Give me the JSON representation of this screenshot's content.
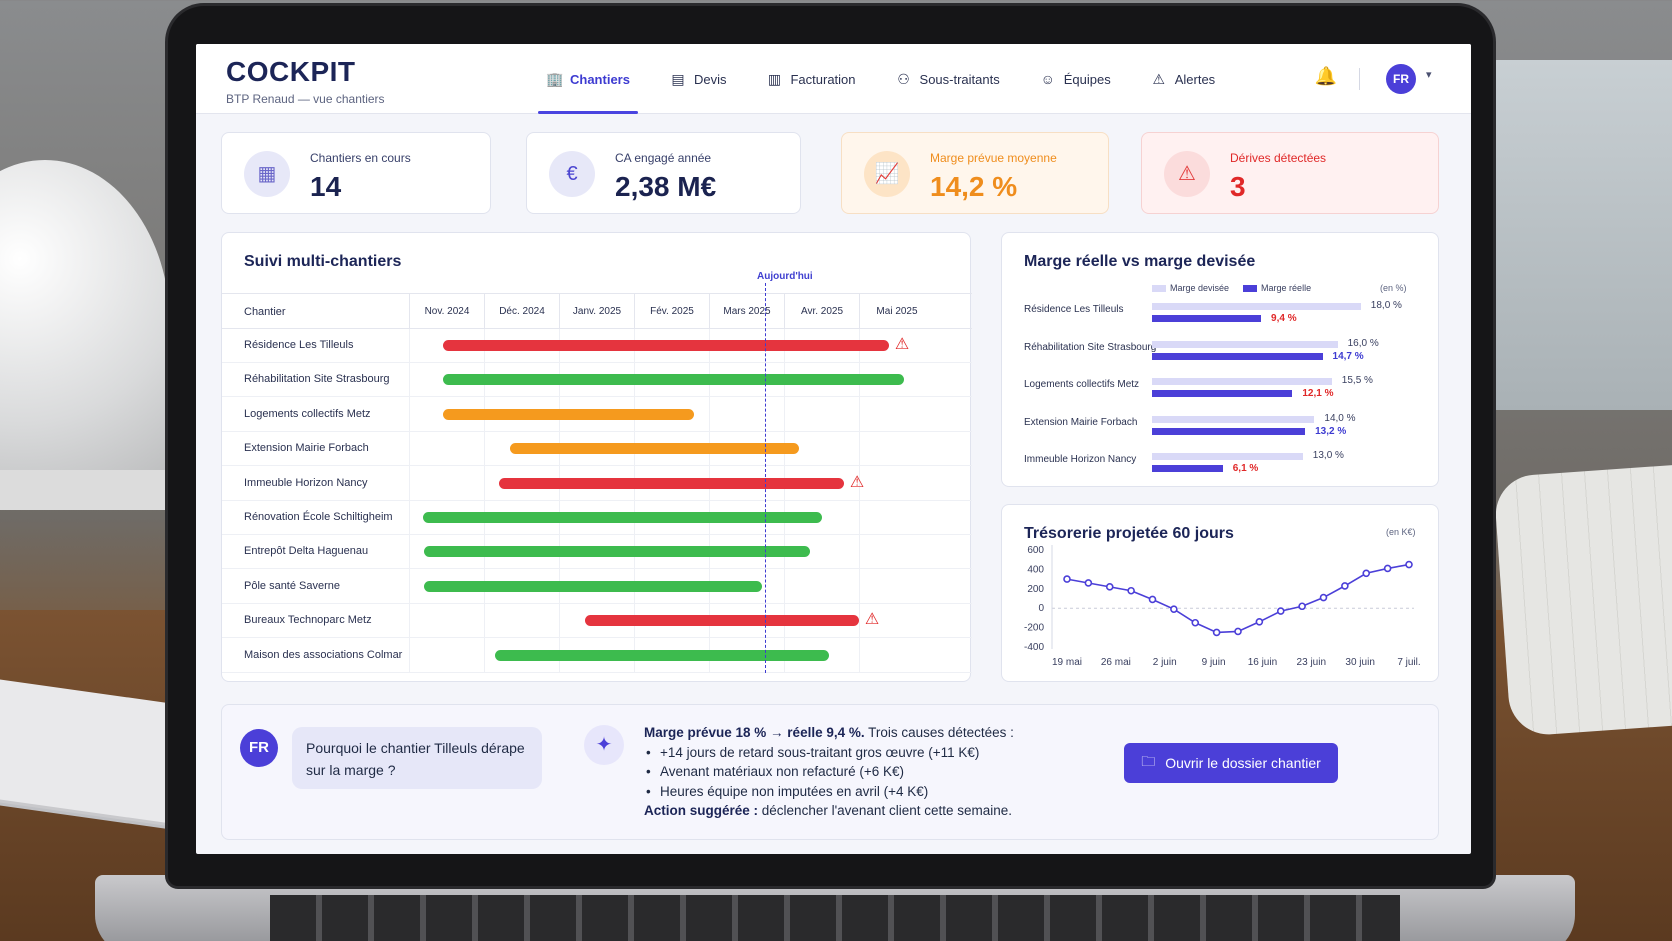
{
  "header": {
    "brand": "COCKPIT",
    "subtitle": "BTP Renaud — vue chantiers",
    "nav": [
      {
        "label": "Chantiers",
        "icon": "building-icon",
        "active": true
      },
      {
        "label": "Devis",
        "icon": "document-icon",
        "active": false
      },
      {
        "label": "Facturation",
        "icon": "invoice-icon",
        "active": false
      },
      {
        "label": "Sous-traitants",
        "icon": "users-icon",
        "active": false
      },
      {
        "label": "Équipes",
        "icon": "team-icon",
        "active": false
      },
      {
        "label": "Alertes",
        "icon": "warning-icon",
        "active": false
      }
    ],
    "avatar": "FR"
  },
  "kpis": [
    {
      "label": "Chantiers en cours",
      "value": "14",
      "icon": "building-icon"
    },
    {
      "label": "CA engagé année",
      "value": "2,38 M€",
      "icon": "euro-icon"
    },
    {
      "label": "Marge prévue moyenne",
      "value": "14,2 %",
      "icon": "trend-icon"
    },
    {
      "label": "Dérives détectées",
      "value": "3",
      "icon": "warning-icon"
    }
  ],
  "gantt": {
    "title": "Suivi multi-chantiers",
    "column_label": "Chantier",
    "today_label": "Aujourd'hui",
    "months": [
      "Nov. 2024",
      "Déc. 2024",
      "Janv. 2025",
      "Fév. 2025",
      "Mars 2025",
      "Avr. 2025",
      "Mai 2025"
    ],
    "rows": [
      {
        "name": "Résidence Les Tilleuls",
        "start": 0.45,
        "end": 6.4,
        "status": "red",
        "alert": true
      },
      {
        "name": "Réhabilitation Site Strasbourg",
        "start": 0.45,
        "end": 6.6,
        "status": "green",
        "alert": false
      },
      {
        "name": "Logements collectifs Metz",
        "start": 0.45,
        "end": 3.8,
        "status": "orange",
        "alert": false
      },
      {
        "name": "Extension Mairie Forbach",
        "start": 1.35,
        "end": 5.2,
        "status": "orange",
        "alert": false
      },
      {
        "name": "Immeuble Horizon Nancy",
        "start": 1.2,
        "end": 5.8,
        "status": "red",
        "alert": true
      },
      {
        "name": "Rénovation École Schiltigheim",
        "start": 0.18,
        "end": 5.5,
        "status": "green",
        "alert": false
      },
      {
        "name": "Entrepôt Delta Haguenau",
        "start": 0.2,
        "end": 5.35,
        "status": "green",
        "alert": false
      },
      {
        "name": "Pôle santé Saverne",
        "start": 0.2,
        "end": 4.7,
        "status": "green",
        "alert": false
      },
      {
        "name": "Bureaux Technoparc Metz",
        "start": 2.35,
        "end": 6.0,
        "status": "red",
        "alert": true
      },
      {
        "name": "Maison des associations Colmar",
        "start": 1.15,
        "end": 5.6,
        "status": "green",
        "alert": false
      }
    ],
    "today_position": 4.75
  },
  "margin_chart": {
    "title": "Marge réelle vs marge devisée",
    "legend_devisee": "Marge devisée",
    "legend_reelle": "Marge réelle",
    "unit": "(en %)",
    "rows": [
      {
        "name": "Résidence Les Tilleuls",
        "devisee": 18.0,
        "reelle": 9.4,
        "devisee_label": "18,0 %",
        "reelle_label": "9,4 %",
        "alert": true
      },
      {
        "name": "Réhabilitation Site Strasbourg",
        "devisee": 16.0,
        "reelle": 14.7,
        "devisee_label": "16,0 %",
        "reelle_label": "14,7 %",
        "alert": false
      },
      {
        "name": "Logements collectifs Metz",
        "devisee": 15.5,
        "reelle": 12.1,
        "devisee_label": "15,5 %",
        "reelle_label": "12,1 %",
        "alert": true
      },
      {
        "name": "Extension Mairie Forbach",
        "devisee": 14.0,
        "reelle": 13.2,
        "devisee_label": "14,0 %",
        "reelle_label": "13,2 %",
        "alert": false
      },
      {
        "name": "Immeuble Horizon Nancy",
        "devisee": 13.0,
        "reelle": 6.1,
        "devisee_label": "13,0 %",
        "reelle_label": "6,1 %",
        "alert": true
      }
    ],
    "colors": {
      "devisee": "#d9d9f7",
      "reelle": "#4b3fd8",
      "alert": "#e02828",
      "ok": "#3d3bd1"
    }
  },
  "chart_data": {
    "type": "line",
    "title": "Trésorerie projetée 60 jours",
    "unit": "(en K€)",
    "yticks": [
      600,
      400,
      200,
      0,
      -200,
      -400
    ],
    "ylim": [
      -400,
      600
    ],
    "xticks": [
      "19 mai",
      "26 mai",
      "2 juin",
      "9 juin",
      "16 juin",
      "23 juin",
      "30 juin",
      "7 juil."
    ],
    "x": [
      0,
      2,
      4,
      6,
      8,
      10,
      12,
      14,
      16,
      18,
      20,
      22,
      24,
      26,
      28,
      30,
      32,
      34,
      36,
      38,
      40,
      42,
      44,
      46,
      48,
      50,
      52,
      54,
      56,
      58
    ],
    "y": [
      300,
      260,
      220,
      180,
      90,
      -10,
      -150,
      -250,
      -240,
      -140,
      -30,
      20,
      110,
      230,
      360,
      410,
      450
    ],
    "series_color": "#4b3fd8"
  },
  "ai": {
    "avatar": "FR",
    "question": "Pourquoi le chantier Tilleuls dérape sur la marge ?",
    "headline_bold": "Marge prévue 18 % → réelle 9,4 %.",
    "headline_rest": " Trois causes détectées :",
    "causes": [
      "+14 jours de retard sous-traitant gros œuvre (+11 K€)",
      "Avenant matériaux non refacturé (+6 K€)",
      "Heures équipe non imputées en avril (+4 K€)"
    ],
    "action_bold": "Action suggérée :",
    "action_rest": " déclencher l'avenant client cette semaine.",
    "cta_label": "Ouvrir le dossier chantier"
  }
}
